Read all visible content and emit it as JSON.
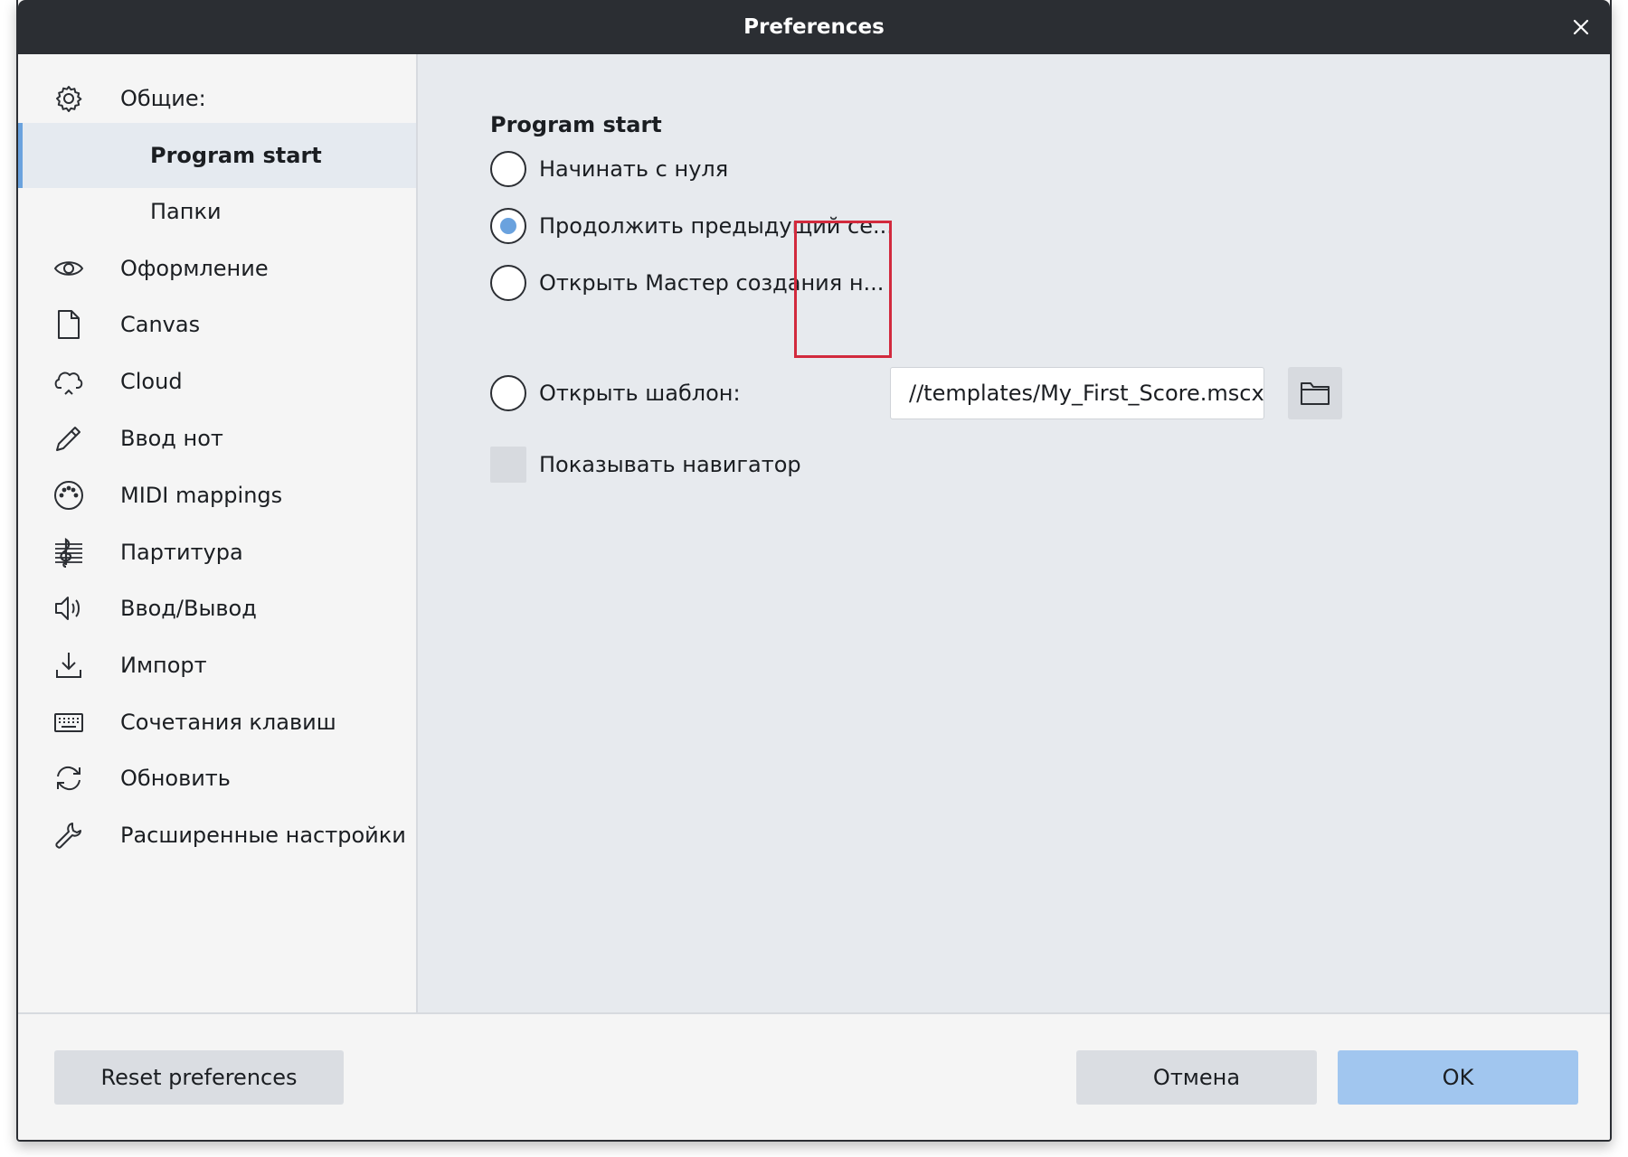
{
  "window": {
    "title": "Preferences"
  },
  "sidebar": {
    "items": [
      {
        "label": "Общие:",
        "icon": "gear-icon"
      },
      {
        "label": "Program start",
        "selected": true
      },
      {
        "label": "Папки"
      },
      {
        "label": "Оформление",
        "icon": "eye-icon"
      },
      {
        "label": "Canvas",
        "icon": "document-icon"
      },
      {
        "label": "Cloud",
        "icon": "cloud-icon"
      },
      {
        "label": "Ввод нот",
        "icon": "pencil-icon"
      },
      {
        "label": "MIDI mappings",
        "icon": "midi-port-icon"
      },
      {
        "label": "Партитура",
        "icon": "score-clef-icon"
      },
      {
        "label": "Ввод/Вывод",
        "icon": "speaker-icon"
      },
      {
        "label": "Импорт",
        "icon": "import-icon"
      },
      {
        "label": "Сочетания клавиш",
        "icon": "keyboard-icon"
      },
      {
        "label": "Обновить",
        "icon": "refresh-icon"
      },
      {
        "label": "Расширенные настройки",
        "icon": "wrench-icon"
      }
    ]
  },
  "content": {
    "section_title": "Program start",
    "options": [
      {
        "label": "Начинать с нуля",
        "checked": false
      },
      {
        "label": "Продолжить предыдущий се...",
        "checked": true
      },
      {
        "label": "Открыть Мастер создания н...",
        "checked": false
      },
      {
        "label": "Открыть шаблон:",
        "checked": false
      }
    ],
    "template_path": "//templates/My_First_Score.mscx",
    "show_navigator": {
      "label": "Показывать навигатор",
      "checked": false
    }
  },
  "footer": {
    "reset_label": "Reset preferences",
    "cancel_label": "Отмена",
    "ok_label": "OK"
  },
  "colors": {
    "accent": "#6aa2de",
    "ok_button": "#a1c6ef",
    "titlebar": "#2b2e33",
    "highlight_box": "#d22a3d"
  }
}
